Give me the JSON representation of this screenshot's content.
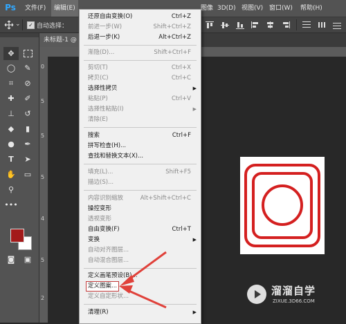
{
  "app": {
    "logo": "Ps"
  },
  "menubar": {
    "items": [
      {
        "label": "文件(F)"
      },
      {
        "label": "编辑(E)"
      },
      {
        "label": "图像"
      },
      {
        "label": "3D(D)"
      },
      {
        "label": "视图(V)"
      },
      {
        "label": "窗口(W)"
      },
      {
        "label": "帮助(H)"
      }
    ]
  },
  "options_bar": {
    "auto_select_label": "自动选择：",
    "auto_select_checked": true,
    "icons": [
      "move-icon",
      "chevron-down-icon",
      "align-top-icon",
      "align-middle-icon",
      "align-bottom-icon",
      "distribute-icon"
    ]
  },
  "tools": {
    "icons": [
      "move-icon",
      "marquee-icon",
      "lasso-icon",
      "quick-select-icon",
      "crop-icon",
      "eyedropper-icon",
      "healing-icon",
      "brush-icon",
      "stamp-icon",
      "history-brush-icon",
      "eraser-icon",
      "gradient-icon",
      "dodge-icon",
      "pen-icon",
      "text-icon",
      "path-select-icon",
      "hand-icon",
      "zoom-icon",
      "more-icon"
    ],
    "foreground_color": "#a31a1a",
    "background_color": "#ffffff"
  },
  "document": {
    "tab_title": "未标题-1 @",
    "ruler_numbers": [
      "0",
      "5",
      "5",
      "5",
      "4",
      "5",
      "2"
    ]
  },
  "edit_menu": {
    "items": [
      {
        "label": "还原自由变换(O)",
        "shortcut": "Ctrl+Z",
        "disabled": false
      },
      {
        "label": "前进一步(W)",
        "shortcut": "Shift+Ctrl+Z",
        "disabled": true
      },
      {
        "label": "后退一步(K)",
        "shortcut": "Alt+Ctrl+Z",
        "disabled": false
      },
      {
        "label": "渐隐(D)...",
        "shortcut": "Shift+Ctrl+F",
        "disabled": true
      },
      {
        "label": "剪切(T)",
        "shortcut": "Ctrl+X",
        "disabled": true
      },
      {
        "label": "拷贝(C)",
        "shortcut": "Ctrl+C",
        "disabled": true
      },
      {
        "label": "选择性拷贝",
        "shortcut": "",
        "disabled": false,
        "submenu": true
      },
      {
        "label": "粘贴(P)",
        "shortcut": "Ctrl+V",
        "disabled": true
      },
      {
        "label": "选择性粘贴(I)",
        "shortcut": "",
        "disabled": true,
        "submenu": true
      },
      {
        "label": "清除(E)",
        "shortcut": "",
        "disabled": true
      },
      {
        "label": "搜索",
        "shortcut": "Ctrl+F",
        "disabled": false
      },
      {
        "label": "拼写检查(H)...",
        "shortcut": "",
        "disabled": false
      },
      {
        "label": "查找和替换文本(X)...",
        "shortcut": "",
        "disabled": false
      },
      {
        "label": "填充(L)...",
        "shortcut": "Shift+F5",
        "disabled": true
      },
      {
        "label": "描边(S)...",
        "shortcut": "",
        "disabled": true
      },
      {
        "label": "内容识别缩放",
        "shortcut": "Alt+Shift+Ctrl+C",
        "disabled": true
      },
      {
        "label": "操控变形",
        "shortcut": "",
        "disabled": false
      },
      {
        "label": "透视变形",
        "shortcut": "",
        "disabled": true
      },
      {
        "label": "自由变换(F)",
        "shortcut": "Ctrl+T",
        "disabled": false
      },
      {
        "label": "变换",
        "shortcut": "",
        "disabled": false,
        "submenu": true
      },
      {
        "label": "自动对齐图层...",
        "shortcut": "",
        "disabled": true
      },
      {
        "label": "自动混合图层...",
        "shortcut": "",
        "disabled": true
      },
      {
        "label": "定义画笔预设(B)...",
        "shortcut": "",
        "disabled": false
      },
      {
        "label": "定义图案...",
        "shortcut": "",
        "disabled": false,
        "highlighted": true
      },
      {
        "label": "定义自定形状...",
        "shortcut": "",
        "disabled": true
      },
      {
        "label": "清理(R)",
        "shortcut": "",
        "disabled": false,
        "submenu": true
      }
    ]
  },
  "annotation": {
    "arrow_color": "#e0413a"
  },
  "watermark": {
    "title": "溜溜自学",
    "url": "ZIXUE.3D66.COM"
  }
}
